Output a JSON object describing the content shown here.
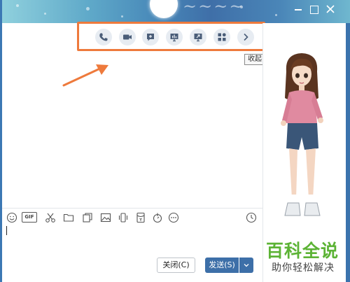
{
  "window": {
    "controls": [
      "minimize",
      "maximize",
      "close"
    ]
  },
  "feature_toolbar": {
    "highlight_color": "#ee7a3c",
    "buttons": [
      {
        "icon": "phone-icon"
      },
      {
        "icon": "video-call-icon"
      },
      {
        "icon": "add-chat-icon"
      },
      {
        "icon": "presentation-icon"
      },
      {
        "icon": "screen-share-icon"
      },
      {
        "icon": "apps-icon"
      },
      {
        "icon": "chevron-right-icon"
      }
    ]
  },
  "tooltip": {
    "text": "收起"
  },
  "input_toolbar": {
    "gif_label": "GIF",
    "icons": [
      "emoji-icon",
      "gif-icon",
      "scissors-icon",
      "folder-icon",
      "image-group-icon",
      "picture-icon",
      "shake-icon",
      "red-packet-icon",
      "voice-icon",
      "more-icon",
      "history-icon"
    ]
  },
  "buttons": {
    "close_label": "关闭(C)",
    "send_label": "发送(S)"
  },
  "watermark": {
    "title": "百科全说",
    "subtitle": "助你轻松解决"
  },
  "colors": {
    "accent_blue": "#3d6fa8",
    "watermark_green": "#5cb335"
  }
}
